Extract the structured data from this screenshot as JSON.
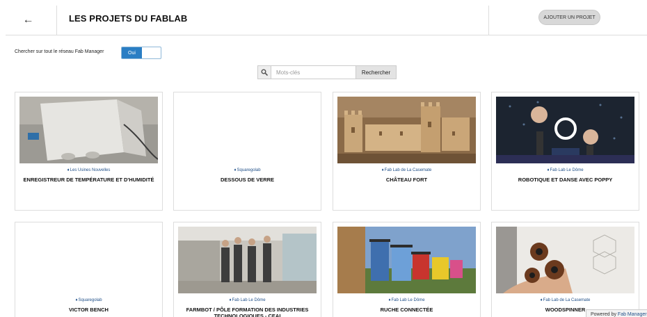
{
  "header": {
    "back_icon": "arrow-left-icon",
    "back_glyph": "←",
    "title": "LES PROJETS DU FABLAB",
    "add_button": "AJOUTER UN PROJET"
  },
  "network_search": {
    "label": "Chercher sur tout le réseau Fab Manager",
    "toggle_value": "Oui"
  },
  "search": {
    "icon": "search-icon",
    "placeholder": "Mots-clés",
    "button": "Rechercher"
  },
  "projects": [
    {
      "lab": "Les Usines Nouvelles",
      "title": "ENREGISTREUR DE TEMPÉRATURE ET D'HUMIDITÉ"
    },
    {
      "lab": "Squaregolab",
      "title": "DESSOUS DE VERRE"
    },
    {
      "lab": "Fab Lab de La Casemate",
      "title": "CHÂTEAU FORT"
    },
    {
      "lab": "Fab Lab Le Dôme",
      "title": "ROBOTIQUE ET DANSE AVEC POPPY"
    },
    {
      "lab": "Squaregolab",
      "title": "VICTOR BENCH"
    },
    {
      "lab": "Fab Lab Le Dôme",
      "title": "FARMBOT / PÔLE FORMATION DES INDUSTRIES TECHNOLOGIQUES - CEAI"
    },
    {
      "lab": "Fab Lab Le Dôme",
      "title": "RUCHE CONNECTÉE"
    },
    {
      "lab": "Fab Lab de La Casemate",
      "title": "WOODSPINNER"
    }
  ],
  "footer": {
    "powered_prefix": "Powered by",
    "powered_brand": "Fab Manager"
  },
  "colors": {
    "accent": "#2a7ec4",
    "lab_link": "#1f4f88",
    "border": "#dddddd"
  }
}
